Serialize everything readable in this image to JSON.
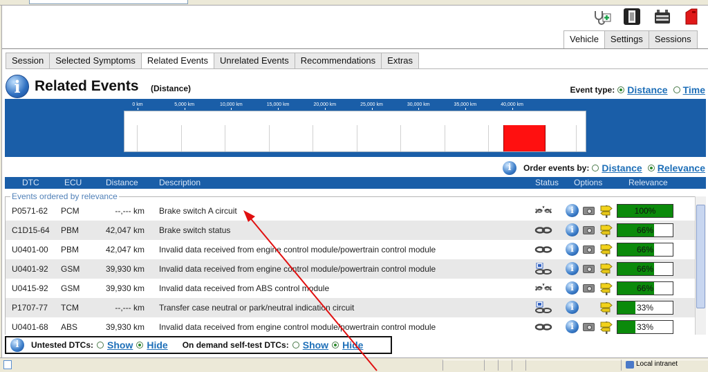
{
  "toolbar": {
    "icons": [
      "stethoscope-icon",
      "device-icon",
      "battery-icon",
      "fuel-can-icon"
    ]
  },
  "top_tabs": [
    {
      "label": "Vehicle",
      "active": true
    },
    {
      "label": "Settings",
      "active": false
    },
    {
      "label": "Sessions",
      "active": false
    }
  ],
  "sub_tabs": [
    {
      "label": "Session",
      "active": false
    },
    {
      "label": "Selected Symptoms",
      "active": false
    },
    {
      "label": "Related Events",
      "active": true
    },
    {
      "label": "Unrelated Events",
      "active": false
    },
    {
      "label": "Recommendations",
      "active": false
    },
    {
      "label": "Extras",
      "active": false
    }
  ],
  "header": {
    "title": "Related Events",
    "subtitle": "(Distance)",
    "event_type_label": "Event type:",
    "event_type_distance": "Distance",
    "event_type_time": "Time",
    "event_type_selected": "Distance"
  },
  "timeline": {
    "ticks": [
      "0 km",
      "5,000 km",
      "10,000 km",
      "15,000 km",
      "20,000 km",
      "25,000 km",
      "30,000 km",
      "35,000 km",
      "40,000 km"
    ],
    "bar_color": "#ff1010",
    "bar_range_km": [
      39000,
      43500
    ]
  },
  "order": {
    "label": "Order events by:",
    "distance": "Distance",
    "relevance": "Relevance",
    "selected": "Relevance"
  },
  "table": {
    "columns": {
      "dtc": "DTC",
      "ecu": "ECU",
      "distance": "Distance",
      "description": "Description",
      "status": "Status",
      "options": "Options",
      "relevance": "Relevance"
    },
    "group_label": "Events ordered by relevance",
    "rows": [
      {
        "dtc": "P0571-62",
        "ecu": "PCM",
        "distance": "--,--- km",
        "description": "Brake switch A circuit",
        "status": "broken-link-icon",
        "camera": true,
        "relevance": 100,
        "relevance_text": "100%"
      },
      {
        "dtc": "C1D15-64",
        "ecu": "PBM",
        "distance": "42,047 km",
        "description": "Brake switch status",
        "status": "chain-icon",
        "camera": true,
        "relevance": 66,
        "relevance_text": "66%"
      },
      {
        "dtc": "U0401-00",
        "ecu": "PBM",
        "distance": "42,047 km",
        "description": "Invalid data received from engine control module/powertrain control module",
        "status": "chain-icon",
        "camera": true,
        "relevance": 66,
        "relevance_text": "66%"
      },
      {
        "dtc": "U0401-92",
        "ecu": "GSM",
        "distance": "39,930 km",
        "description": "Invalid data received from engine control module/powertrain control module",
        "status": "module-chain-icon",
        "camera": true,
        "relevance": 66,
        "relevance_text": "66%"
      },
      {
        "dtc": "U0415-92",
        "ecu": "GSM",
        "distance": "39,930 km",
        "description": "Invalid data received from ABS control module",
        "status": "broken-link-icon",
        "camera": true,
        "relevance": 66,
        "relevance_text": "66%"
      },
      {
        "dtc": "P1707-77",
        "ecu": "TCM",
        "distance": "--,--- km",
        "description": "Transfer case neutral or park/neutral indication circuit",
        "status": "module-chain-icon",
        "camera": false,
        "relevance": 33,
        "relevance_text": "33%"
      },
      {
        "dtc": "U0401-68",
        "ecu": "ABS",
        "distance": "39,930 km",
        "description": "Invalid data received from engine control module/powertrain control module",
        "status": "chain-icon",
        "camera": true,
        "relevance": 33,
        "relevance_text": "33%"
      }
    ]
  },
  "bottom": {
    "untested_label": "Untested DTCs:",
    "show": "Show",
    "hide": "Hide",
    "untested_selected": "Hide",
    "ondemand_label": "On demand self-test DTCs:",
    "ondemand_selected": "Hide"
  },
  "statusbar": {
    "zone": "Local intranet"
  },
  "colors": {
    "accent_blue": "#1a5ea8",
    "relevance_green": "#0b8a0b",
    "link": "#1e6fb8",
    "annotation_arrow": "#e01010"
  }
}
